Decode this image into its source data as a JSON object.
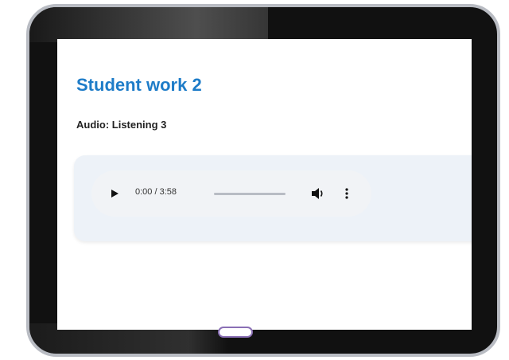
{
  "page": {
    "title": "Student work 2",
    "section_label": "Audio: Listening 3"
  },
  "audio_player": {
    "time": "0:00 / 3:58",
    "progress": 0.0,
    "play_icon": "play-icon",
    "volume_icon": "volume-icon",
    "more_icon": "more-vertical-icon"
  },
  "device": {
    "home_button_color": "#8a6fb5",
    "accent_color": "#1e7cc8"
  }
}
